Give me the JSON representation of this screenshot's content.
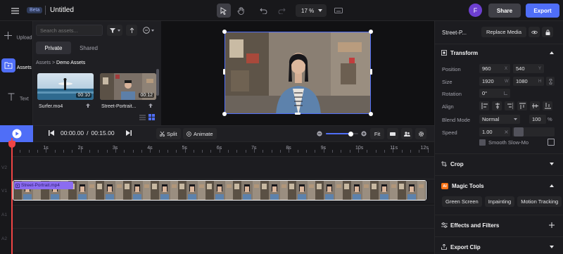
{
  "topbar": {
    "beta_label": "Beta",
    "project_title": "Untitled",
    "zoom_value": "17 %",
    "avatar_initial": "F",
    "share_label": "Share",
    "export_label": "Export"
  },
  "rail": {
    "items": [
      {
        "label": "Upload",
        "icon": "plus-icon"
      },
      {
        "label": "Assets",
        "icon": "folder-icon"
      },
      {
        "label": "Text",
        "icon": "text-icon"
      }
    ]
  },
  "assets": {
    "search_placeholder": "Search assets...",
    "tabs": [
      "Private",
      "Shared"
    ],
    "breadcrumb_root": "Assets",
    "breadcrumb_sep": ">",
    "breadcrumb_current": "Demo Assets",
    "items": [
      {
        "name": "Surfer.mo4",
        "duration": "00:10"
      },
      {
        "name": "Street-Portrait...",
        "duration": "00:12"
      }
    ]
  },
  "timeline": {
    "current_time": "00:00.00",
    "separator": "/",
    "total_time": "00:15.00",
    "split_label": "Split",
    "animate_label": "Animate",
    "fit_label": "Fit",
    "zoom_fraction": 0.78,
    "ruler_labels": [
      "1s",
      "2s",
      "3s",
      "4s",
      "5s",
      "6s",
      "7s",
      "8s",
      "9s",
      "10s",
      "11s",
      "12s"
    ],
    "track_labels": [
      "V2",
      "V1",
      "A1",
      "A2"
    ],
    "clip_name": "Street-Portrait.mp4"
  },
  "right_panel": {
    "asset_name": "Street-P...",
    "replace_label": "Replace Media",
    "transform": {
      "title": "Transform",
      "position_label": "Position",
      "position_x": "960",
      "position_y": "540",
      "size_label": "Size",
      "size_w": "1920",
      "size_h": "1080",
      "rotation_label": "Rotation",
      "rotation_value": "0°",
      "align_label": "Align",
      "blend_label": "Blend Mode",
      "blend_value": "Normal",
      "opacity_value": "100",
      "opacity_unit": "%",
      "speed_label": "Speed",
      "speed_value": "1.00",
      "smooth_label": "Smooth Slow-Mo",
      "unit_x": "X",
      "unit_y": "Y",
      "unit_w": "W",
      "unit_h": "H"
    },
    "crop_title": "Crop",
    "magic_title": "Magic Tools",
    "magic_badge": "AI",
    "magic_tools": [
      "Green Screen",
      "Inpainting",
      "Motion Tracking"
    ],
    "effects_title": "Effects and Filters",
    "export_clip_title": "Export Clip"
  },
  "colors": {
    "accent": "#4f6ef7",
    "playhead": "#ef4444",
    "clip_label": "#8b6cf0"
  }
}
